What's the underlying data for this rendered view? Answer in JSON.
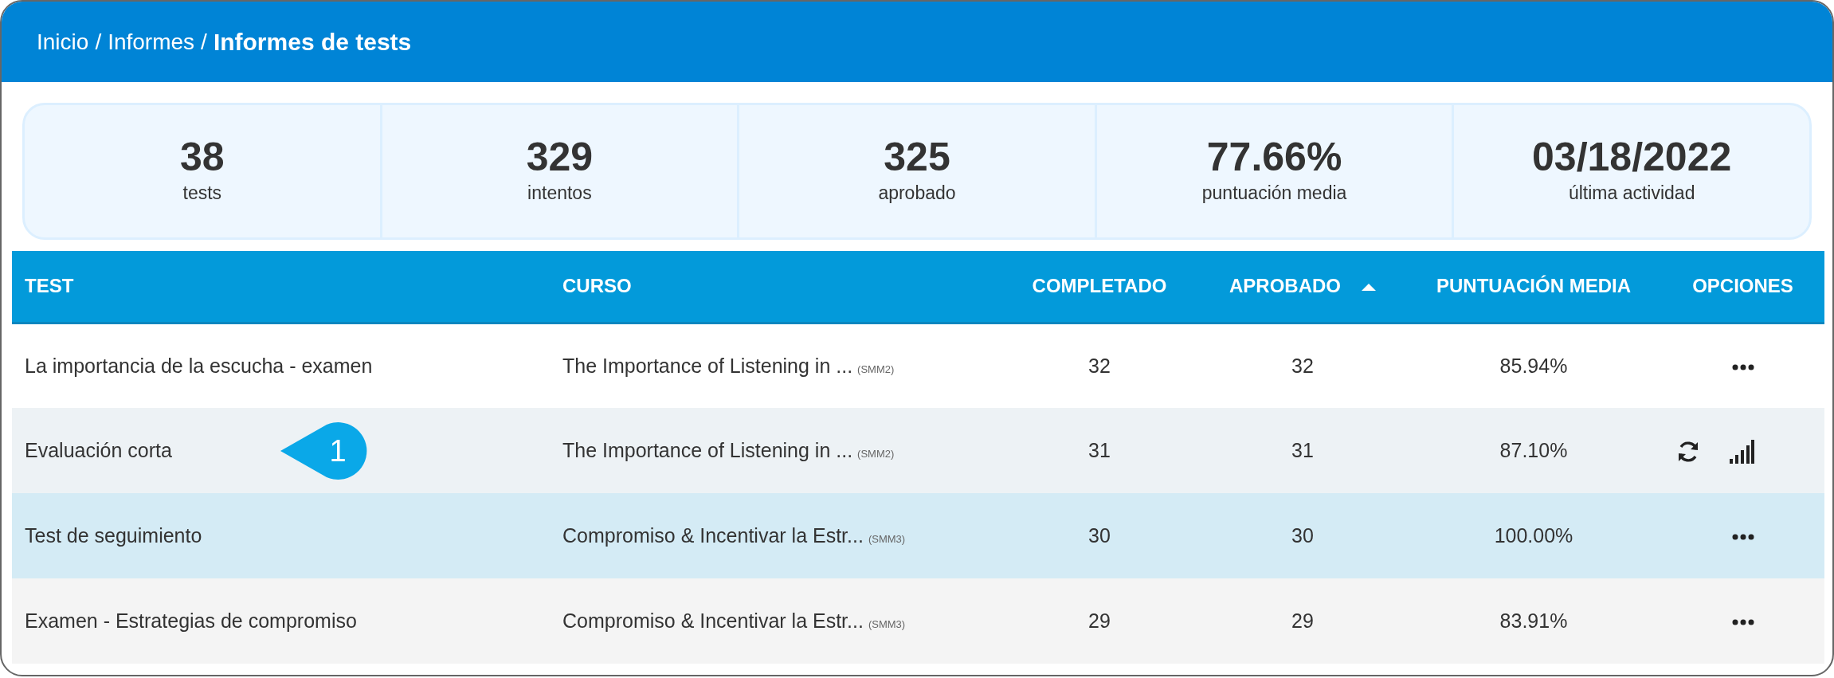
{
  "breadcrumb": {
    "items": [
      "Inicio",
      "Informes"
    ],
    "separator": "/",
    "current": "Informes de tests"
  },
  "stats": [
    {
      "value": "38",
      "label": "tests"
    },
    {
      "value": "329",
      "label": "intentos"
    },
    {
      "value": "325",
      "label": "aprobado"
    },
    {
      "value": "77.66%",
      "label": "puntuación media"
    },
    {
      "value": "03/18/2022",
      "label": "última actividad"
    }
  ],
  "table": {
    "columns": [
      {
        "label": "TEST",
        "sorted": false
      },
      {
        "label": "CURSO",
        "sorted": false
      },
      {
        "label": "COMPLETADO",
        "sorted": false
      },
      {
        "label": "APROBADO",
        "sorted": true
      },
      {
        "label": "PUNTUACIÓN MEDIA",
        "sorted": false
      },
      {
        "label": "OPCIONES",
        "sorted": false
      }
    ],
    "rows": [
      {
        "test": "La importancia de la escucha - examen",
        "course": "The Importance of Listening in ...",
        "code": "(SMM2)",
        "completed": "32",
        "passed": "32",
        "score": "85.94%",
        "hovered": false,
        "selected": false
      },
      {
        "test": "Evaluación corta",
        "course": "The Importance of Listening in ...",
        "code": "(SMM2)",
        "completed": "31",
        "passed": "31",
        "score": "87.10%",
        "hovered": true,
        "selected": false,
        "callout": "1"
      },
      {
        "test": "Test de seguimiento",
        "course": "Compromiso & Incentivar la Estr...",
        "code": "(SMM3)",
        "completed": "30",
        "passed": "30",
        "score": "100.00%",
        "hovered": false,
        "selected": true
      },
      {
        "test": "Examen - Estrategias de compromiso",
        "course": "Compromiso & Incentivar la Estr...",
        "code": "(SMM3)",
        "completed": "29",
        "passed": "29",
        "score": "83.91%",
        "hovered": false,
        "selected": false
      }
    ]
  }
}
